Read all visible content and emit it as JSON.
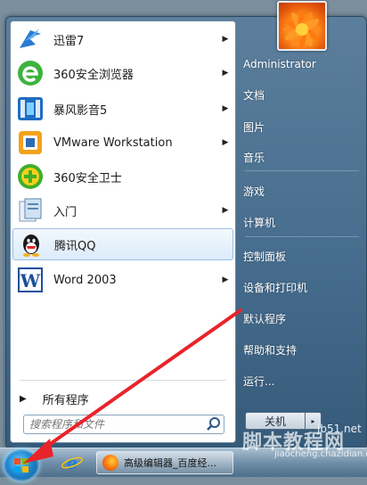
{
  "programs": [
    {
      "label": "迅雷7",
      "icon": "xunlei-icon",
      "has_submenu": true
    },
    {
      "label": "360安全浏览器",
      "icon": "360-browser-icon",
      "has_submenu": true
    },
    {
      "label": "暴风影音5",
      "icon": "baofeng-icon",
      "has_submenu": true
    },
    {
      "label": "VMware Workstation",
      "icon": "vmware-icon",
      "has_submenu": true
    },
    {
      "label": "360安全卫士",
      "icon": "360-safe-icon",
      "has_submenu": false
    },
    {
      "label": "入门",
      "icon": "getting-started-icon",
      "has_submenu": true
    },
    {
      "label": "腾讯QQ",
      "icon": "qq-icon",
      "has_submenu": false,
      "selected": true
    },
    {
      "label": "Word 2003",
      "icon": "word-icon",
      "has_submenu": true
    }
  ],
  "all_programs": "所有程序",
  "search": {
    "placeholder": "搜索程序和文件"
  },
  "right": {
    "user": "Administrator",
    "documents": "文档",
    "pictures": "图片",
    "music": "音乐",
    "games": "游戏",
    "computer": "计算机",
    "control_panel": "控制面板",
    "devices_printers": "设备和打印机",
    "default_programs": "默认程序",
    "help_support": "帮助和支持",
    "run": "运行..."
  },
  "shutdown": {
    "label": "关机",
    "arrow": "▸"
  },
  "taskbar": {
    "window_title": "高级编辑器_百度经..."
  },
  "watermark": {
    "text1": "脚本教程网",
    "text2": "jb51.net",
    "text3": "jiaocheng.chazidian.com"
  },
  "colors": {
    "selected_bg": "#dcebfb",
    "arrow_red": "#e8242a",
    "menu_blue": "#476d8e"
  }
}
